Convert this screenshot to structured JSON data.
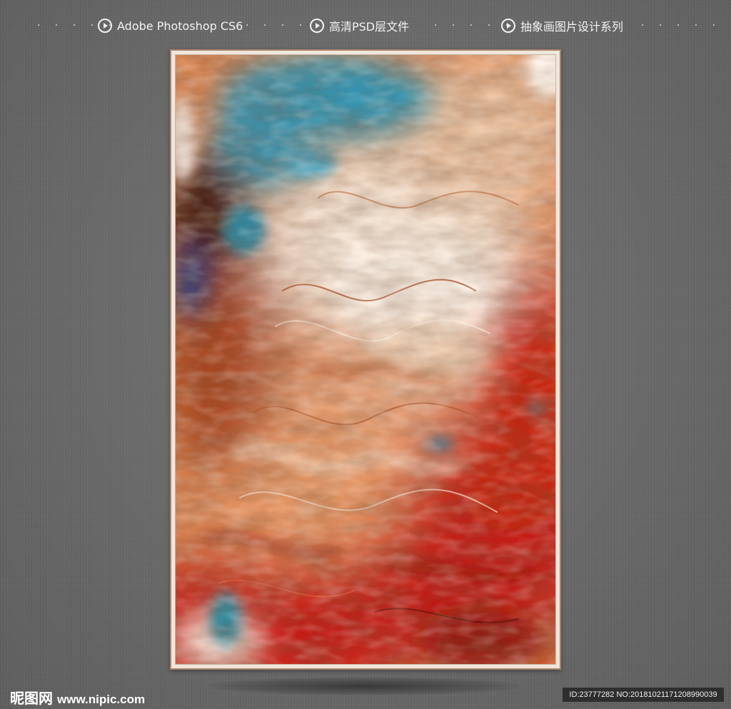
{
  "banner": {
    "items": [
      {
        "label": "Adobe Photoshop CS6",
        "icon": "play-circle-icon"
      },
      {
        "label": "高清PSD层文件",
        "icon": "play-circle-icon"
      },
      {
        "label": "抽象画图片设计系列",
        "icon": "play-circle-icon"
      }
    ],
    "separator": "· · · · ·"
  },
  "artwork": {
    "colors": {
      "red": "#c41a12",
      "orange": "#d9733f",
      "cream": "#f6e6d6",
      "teal": "#2e97b8",
      "navy": "#1f3f88",
      "dark": "#4a2416"
    }
  },
  "footer": {
    "logo_cn": "昵图网",
    "logo_url": "www.nipic.com",
    "id_text": "ID:23777282 NO:20181021171208990039"
  }
}
